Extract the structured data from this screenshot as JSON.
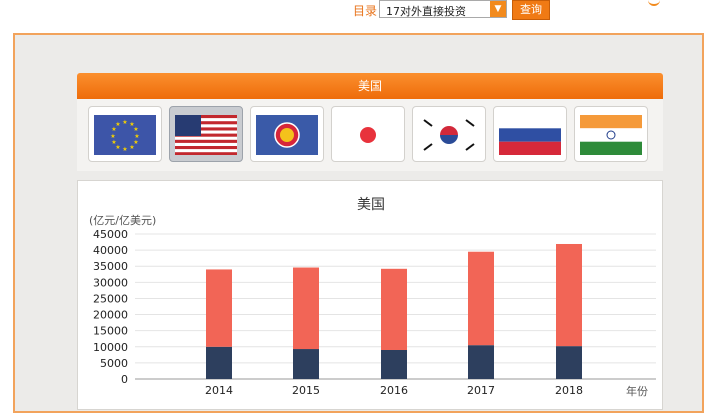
{
  "toolbar": {
    "toc_label": "目录",
    "select_value": "17对外直接投资",
    "query_label": "查询"
  },
  "region_header": "美国",
  "flags": [
    {
      "icon": "eu-flag-icon",
      "selected": false
    },
    {
      "icon": "usa-flag-icon",
      "selected": true
    },
    {
      "icon": "asean-flag-icon",
      "selected": false
    },
    {
      "icon": "japan-flag-icon",
      "selected": false
    },
    {
      "icon": "korea-flag-icon",
      "selected": false
    },
    {
      "icon": "russia-flag-icon",
      "selected": false
    },
    {
      "icon": "india-flag-icon",
      "selected": false
    }
  ],
  "chart_data": {
    "type": "bar",
    "stacked": true,
    "title": "美国",
    "ylabel": "(亿元/亿美元)",
    "xlabel": "年份",
    "categories": [
      "2014",
      "2015",
      "2016",
      "2017",
      "2018"
    ],
    "ylim": [
      0,
      45000
    ],
    "yticks": [
      "0",
      "5000",
      "10000",
      "15000",
      "20000",
      "25000",
      "30000",
      "35000",
      "40000",
      "45000"
    ],
    "series": [
      {
        "color": "#2d3f5e",
        "values": [
          10000,
          9300,
          9000,
          10500,
          10200
        ]
      },
      {
        "color": "#f26556",
        "values": [
          24000,
          25300,
          25200,
          29000,
          31700
        ]
      }
    ],
    "grid": true,
    "legend": "none"
  }
}
